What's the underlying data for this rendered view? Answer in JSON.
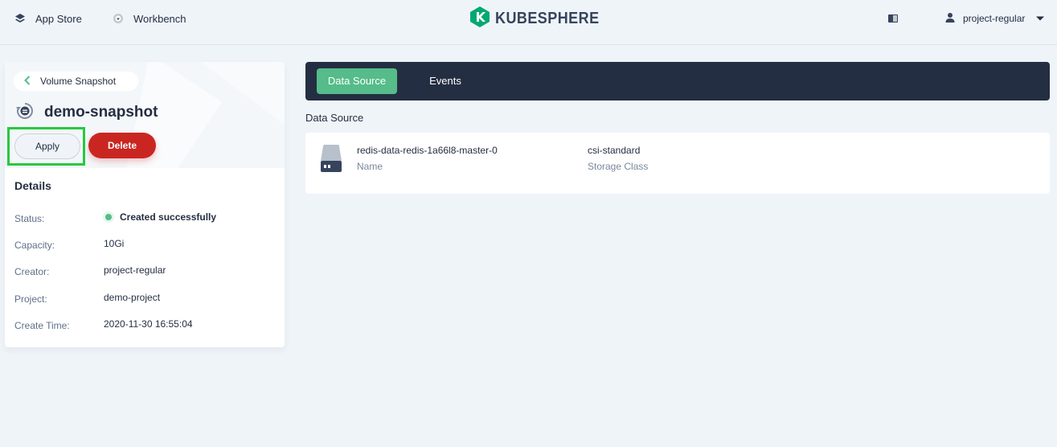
{
  "header": {
    "nav": [
      {
        "label": "App Store",
        "icon": "app-store-icon"
      },
      {
        "label": "Workbench",
        "icon": "workbench-icon"
      }
    ],
    "logo_text": "KUBESPHERE",
    "user": {
      "name": "project-regular",
      "icon": "user-icon"
    }
  },
  "left_panel": {
    "back_label": "Volume Snapshot",
    "title": "demo-snapshot",
    "buttons": {
      "apply": "Apply",
      "delete": "Delete"
    },
    "details_title": "Details",
    "details": [
      {
        "label": "Status:",
        "value": "Created successfully"
      },
      {
        "label": "Capacity:",
        "value": "10Gi"
      },
      {
        "label": "Creator:",
        "value": "project-regular"
      },
      {
        "label": "Project:",
        "value": "demo-project"
      },
      {
        "label": "Create Time:",
        "value": "2020-11-30 16:55:04"
      }
    ],
    "status_color": "#55bc8a"
  },
  "tabs": [
    {
      "label": "Data Source",
      "active": true
    },
    {
      "label": "Events",
      "active": false
    }
  ],
  "data_source": {
    "section_title": "Data Source",
    "name": "redis-data-redis-1a66l8-master-0",
    "name_label": "Name",
    "storage_class": "csi-standard",
    "storage_class_label": "Storage Class"
  },
  "colors": {
    "accent_green": "#55bc8a",
    "danger_red": "#ca2621",
    "dark_nav": "#242e42",
    "highlight": "#27c93f"
  }
}
